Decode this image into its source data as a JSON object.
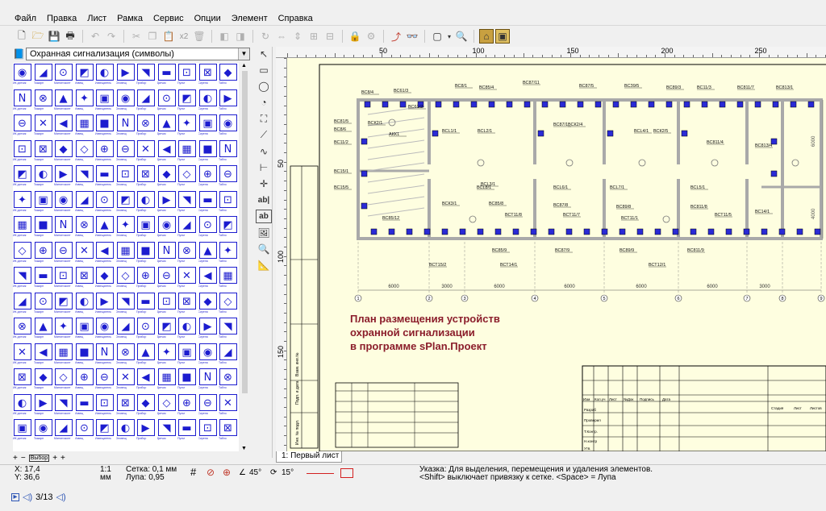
{
  "menu": [
    "Файл",
    "Правка",
    "Лист",
    "Рамка",
    "Сервис",
    "Опции",
    "Элемент",
    "Справка"
  ],
  "toolbar": {
    "buttons": [
      "new-icon",
      "open-icon",
      "save-icon",
      "print-icon",
      "undo-icon",
      "redo-icon",
      "cut-icon",
      "copy-icon",
      "paste-icon",
      "duplicate-icon",
      "delete-icon",
      "to-front-icon",
      "to-back-icon",
      "rotate-icon",
      "mirror-h-icon",
      "mirror-v-icon",
      "group-icon",
      "lock-icon",
      "unlock-icon",
      "properties-icon",
      "binoculars-icon",
      "grid-toggle-icon",
      "zoom-icon",
      "image-icon",
      "image-frame-icon"
    ],
    "x2_label": "x2"
  },
  "library": {
    "selected": "Охранная сигнализация (символы)"
  },
  "palette_captions": [
    "ИК датчик",
    "Пожарн",
    "Магнитоконт",
    "Извещ",
    "Извещатель",
    "Оповещ",
    "Прибор",
    "Датчик",
    "Пульт",
    "Сирена",
    "Табло"
  ],
  "palette_bottom": {
    "plus": "+",
    "minus": "−",
    "select": "Выбор"
  },
  "rulers": {
    "top": [
      "50",
      "100",
      "150",
      "200",
      "250"
    ],
    "left": [
      "50",
      "100",
      "150"
    ]
  },
  "drawing": {
    "title_lines": [
      "План размещения устройств",
      "охранной сигнализации",
      "в программе sPlan.Проект"
    ],
    "dimensions": [
      "6000",
      "3000",
      "6000",
      "6000",
      "6000",
      "6000",
      "3000"
    ],
    "axis_marks": [
      "1",
      "2",
      "3",
      "4",
      "5",
      "6",
      "7",
      "8",
      "9"
    ],
    "side_dims": [
      "6000",
      "4000"
    ],
    "table_headers": [
      "Изм",
      "Кол.уч",
      "Лист",
      "№Док",
      "Подпись",
      "Дата",
      "Стадия",
      "Лист",
      "Листов"
    ],
    "table_rows": [
      "Разраб",
      "Проверил",
      "Т.Контр.",
      "Н.контр",
      "Утв."
    ],
    "stamp_left": [
      "Взам. инв.№",
      "Подп. и дата",
      "Инв. № подл."
    ],
    "labels": [
      "ВС8/4",
      "ВС61/3",
      "ВС61/2",
      "ВС8/1",
      "ВС85/4",
      "ВС87/11",
      "ВС87/5",
      "ВСЗ9/5",
      "ВС89/3",
      "ВС11/3",
      "ВС811/7",
      "ВС813/1",
      "ВС81/5",
      "ВС8/6",
      "ВС11/2",
      "ВС15/1",
      "ВС15/5",
      "ВСК2/1",
      "ВСL1/1",
      "ВСL2/1",
      "ВС87/1",
      "ВСК2/4",
      "ВСL4/1",
      "ВСК2/5",
      "ВС811/4",
      "ВС813/4",
      "ВСL8/1",
      "ВСК3/1",
      "ВС85/8",
      "ВСТ11/8",
      "ВС87/8",
      "ВСТ11/7",
      "ВС89/8",
      "ВСТ11/1",
      "ВС811/8",
      "ВСТ11/5",
      "ВС14/1",
      "ВС85/9",
      "ВС87/9",
      "ВС89/9",
      "ВС811/9",
      "ВСТ12/1",
      "ВСТ14/1",
      "ВСТ15/2",
      "ВСL5/1",
      "ВСL6/1",
      "ВСL7/1",
      "ВСL3/1",
      "АКК1",
      "ВС85/12"
    ]
  },
  "sheet_tab": "1: Первый лист",
  "status": {
    "x": "X: 17,4",
    "y": "Y: 36,6",
    "scale_top": "1:1",
    "scale_unit": "мм",
    "grid": "Сетка: 0,1 мм",
    "zoom": "Лупа: 0,95",
    "angle1": "45°",
    "angle2": "15°",
    "hint_line1": "Указка: Для выделения, перемещения и удаления элементов.",
    "hint_line2": "<Shift> выключает привязку к сетке. <Space> = Лупа"
  },
  "footer": {
    "page": "3/13"
  }
}
